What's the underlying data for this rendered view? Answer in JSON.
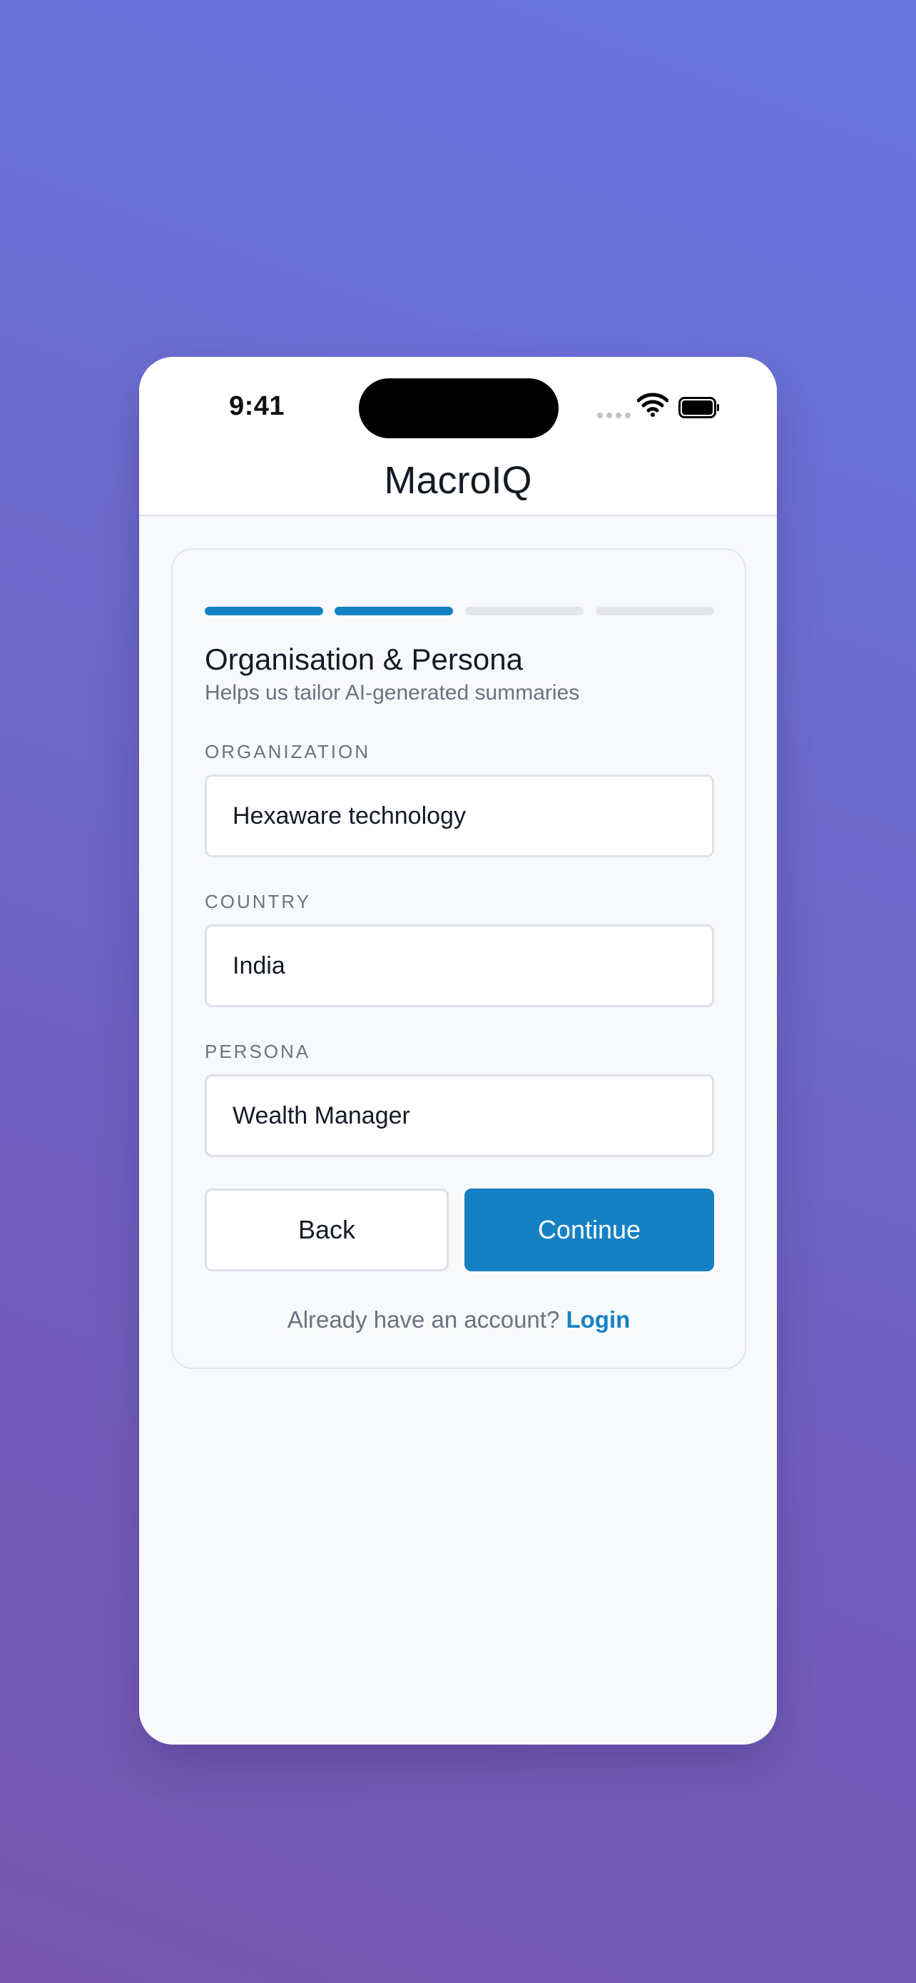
{
  "status_bar": {
    "time": "9:41",
    "icons": [
      "cellular-icon",
      "wifi-icon",
      "battery-icon"
    ]
  },
  "app": {
    "title": "MacroIQ"
  },
  "colors": {
    "accent": "#1581c4",
    "inactive_segment": "#e4e6ea"
  },
  "progress": {
    "total_steps": 4,
    "current_step": 2
  },
  "step": {
    "title": "Organisation & Persona",
    "subtitle": "Helps us tailor AI-generated summaries"
  },
  "fields": {
    "organization": {
      "label": "ORGANIZATION",
      "value": "Hexaware technology"
    },
    "country": {
      "label": "COUNTRY",
      "value": "India"
    },
    "persona": {
      "label": "PERSONA",
      "value": "Wealth Manager"
    }
  },
  "buttons": {
    "back": "Back",
    "continue": "Continue"
  },
  "footer": {
    "prompt": "Already have an account?",
    "login": "Login"
  }
}
